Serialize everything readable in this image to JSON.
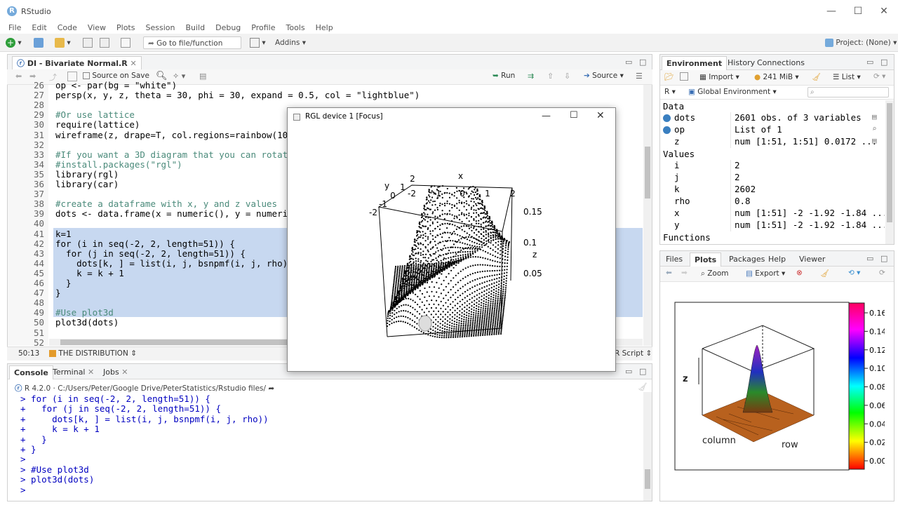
{
  "app": {
    "title": "RStudio",
    "project": "Project: (None)"
  },
  "menu": [
    "File",
    "Edit",
    "Code",
    "View",
    "Plots",
    "Session",
    "Build",
    "Debug",
    "Profile",
    "Tools",
    "Help"
  ],
  "toolbar": {
    "goto_label": "Go to file/function",
    "addins_label": "Addins"
  },
  "editor": {
    "tab_label": "DI - Bivariate Normal.R",
    "source_on_save": "Source on Save",
    "run_label": "Run",
    "source_label": "Source",
    "lines": [
      {
        "n": "26",
        "t": "op <- par(bg = \"white\")"
      },
      {
        "n": "27",
        "t": "persp(x, y, z, theta = 30, phi = 30, expand = 0.5, col = \"lightblue\")"
      },
      {
        "n": "28",
        "t": ""
      },
      {
        "n": "29",
        "t": "#Or use lattice"
      },
      {
        "n": "30",
        "t": "require(lattice)"
      },
      {
        "n": "31",
        "t": "wireframe(z, drape=T, col.regions=rainbow(10"
      },
      {
        "n": "32",
        "t": ""
      },
      {
        "n": "33",
        "t": "#If you want a 3D diagram that you can rotat"
      },
      {
        "n": "34",
        "t": "#install.packages(\"rgl\")"
      },
      {
        "n": "35",
        "t": "library(rgl)"
      },
      {
        "n": "36",
        "t": "library(car)"
      },
      {
        "n": "37",
        "t": ""
      },
      {
        "n": "38",
        "t": "#create a dataframe with x, y and z values"
      },
      {
        "n": "39",
        "t": "dots <- data.frame(x = numeric(), y = numeri"
      },
      {
        "n": "40",
        "t": ""
      },
      {
        "n": "41",
        "t": "k=1"
      },
      {
        "n": "42",
        "t": "for (i in seq(-2, 2, length=51)) {"
      },
      {
        "n": "43",
        "t": "  for (j in seq(-2, 2, length=51)) {"
      },
      {
        "n": "44",
        "t": "    dots[k, ] = list(i, j, bsnpmf(i, j, rho)"
      },
      {
        "n": "45",
        "t": "    k = k + 1"
      },
      {
        "n": "46",
        "t": "  }"
      },
      {
        "n": "47",
        "t": "}"
      },
      {
        "n": "48",
        "t": ""
      },
      {
        "n": "49",
        "t": "#Use plot3d"
      },
      {
        "n": "50",
        "t": "plot3d(dots)"
      },
      {
        "n": "51",
        "t": ""
      },
      {
        "n": "52",
        "t": ""
      }
    ],
    "cursor_pos": "50:13",
    "section": "THE DISTRIBUTION",
    "file_type": "R Script"
  },
  "console": {
    "tabs": [
      "Console",
      "Terminal",
      "Jobs"
    ],
    "r_version": "R 4.2.0",
    "path": "C:/Users/Peter/Google Drive/PeterStatistics/Rstudio files/",
    "lines": [
      "> for (i in seq(-2, 2, length=51)) {",
      "+   for (j in seq(-2, 2, length=51)) {",
      "+     dots[k, ] = list(i, j, bsnpmf(i, j, rho))",
      "+     k = k + 1",
      "+   }",
      "+ }",
      ">",
      "> #Use plot3d",
      "> plot3d(dots)",
      "> "
    ]
  },
  "environment": {
    "tabs": [
      "Environment",
      "History",
      "Connections"
    ],
    "import_label": "Import",
    "memory": "241 MiB",
    "list_label": "List",
    "lang": "R",
    "scope": "Global Environment",
    "data_header": "Data",
    "data": [
      {
        "name": "dots",
        "value": "2601 obs. of 3 variables"
      },
      {
        "name": "op",
        "value": "List of  1"
      },
      {
        "name": "z",
        "value": "num [1:51, 1:51] 0.0172 ..."
      }
    ],
    "values_header": "Values",
    "values": [
      {
        "name": "i",
        "value": "2"
      },
      {
        "name": "j",
        "value": "2"
      },
      {
        "name": "k",
        "value": "2602"
      },
      {
        "name": "rho",
        "value": "0.8"
      },
      {
        "name": "x",
        "value": "num [1:51] -2 -1.92 -1.84 ..."
      },
      {
        "name": "y",
        "value": "num [1:51] -2 -1.92 -1.84 ..."
      }
    ],
    "functions_header": "Functions"
  },
  "files": {
    "tabs": [
      "Files",
      "Plots",
      "Packages",
      "Help",
      "Viewer"
    ],
    "zoom_label": "Zoom",
    "export_label": "Export",
    "plot": {
      "z_label": "z",
      "column_label": "column",
      "row_label": "row",
      "colorbar_ticks": [
        "0.16",
        "0.14",
        "0.12",
        "0.10",
        "0.08",
        "0.06",
        "0.04",
        "0.02",
        "0.00"
      ]
    }
  },
  "rgl": {
    "title": "RGL device 1 [Focus]",
    "x_label": "x",
    "y_label": "y",
    "z_label": "z",
    "x_ticks": [
      "-2",
      "-1",
      "0",
      "1",
      "2"
    ],
    "y_ticks": [
      "-2",
      "-1",
      "0",
      "1",
      "2"
    ],
    "z_ticks": [
      "0.15",
      "0.1",
      "0.05"
    ]
  }
}
